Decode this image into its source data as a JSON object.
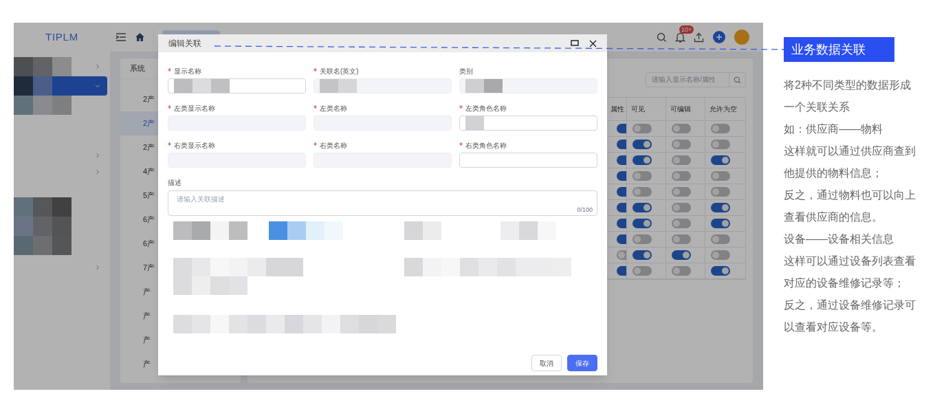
{
  "app": {
    "logo": "TIPLM",
    "notification_badge": "10+"
  },
  "sidebar": {
    "items": [
      {
        "selected": false,
        "kind": "group",
        "expanded": false
      },
      {
        "selected": true,
        "kind": "group",
        "expanded": true
      },
      {
        "selected": false,
        "kind": "item"
      }
    ]
  },
  "list": {
    "header": "系统",
    "items": [
      {
        "label": "2产",
        "selected": false
      },
      {
        "label": "2产",
        "selected": true
      },
      {
        "label": "2产",
        "selected": false
      },
      {
        "label": "4产",
        "selected": false
      },
      {
        "label": "5产",
        "selected": false
      },
      {
        "label": "6产",
        "selected": false
      },
      {
        "label": "6产",
        "selected": false
      },
      {
        "label": "7产",
        "selected": false
      },
      {
        "label": "产",
        "selected": false
      },
      {
        "label": "产",
        "selected": false
      },
      {
        "label": "产",
        "selected": false
      },
      {
        "label": "产",
        "selected": false
      }
    ]
  },
  "search": {
    "placeholder": "请输入显示名称/属性"
  },
  "table": {
    "columns": [
      "属性",
      "可见",
      "可编辑",
      "允许为空"
    ],
    "rows": [
      {
        "toggles": [
          true,
          false,
          false,
          false
        ]
      },
      {
        "toggles": [
          true,
          true,
          false,
          false
        ]
      },
      {
        "toggles": [
          true,
          true,
          false,
          true
        ]
      },
      {
        "toggles": [
          true,
          false,
          false,
          false
        ]
      },
      {
        "toggles": [
          true,
          false,
          false,
          false
        ]
      },
      {
        "toggles": [
          true,
          true,
          false,
          true
        ]
      },
      {
        "toggles": [
          true,
          true,
          false,
          true
        ]
      },
      {
        "toggles": [
          true,
          false,
          false,
          false
        ]
      },
      {
        "toggles": [
          false,
          true,
          true,
          false
        ]
      },
      {
        "toggles": [
          true,
          false,
          false,
          true
        ]
      }
    ]
  },
  "dialog": {
    "title": "编辑关联",
    "fields": [
      {
        "label": "显示名称",
        "required": true,
        "disabled": false,
        "masked": true
      },
      {
        "label": "关联名(英文)",
        "required": true,
        "disabled": true,
        "masked": true
      },
      {
        "label": "类别",
        "required": false,
        "disabled": true,
        "masked": true
      },
      {
        "label": "左类显示名称",
        "required": true,
        "disabled": true,
        "masked": false
      },
      {
        "label": "左类名称",
        "required": true,
        "disabled": true,
        "masked": false
      },
      {
        "label": "左类角色名称",
        "required": true,
        "disabled": false,
        "masked": true
      },
      {
        "label": "右类显示名称",
        "required": true,
        "disabled": true,
        "masked": false
      },
      {
        "label": "右类名称",
        "required": true,
        "disabled": true,
        "masked": false
      },
      {
        "label": "右类角色名称",
        "required": true,
        "disabled": false,
        "masked": false
      }
    ],
    "description": {
      "label": "描述",
      "placeholder": "请输入关联描述",
      "counter": "0/100"
    },
    "buttons": [
      {
        "label": "取消",
        "kind": "secondary"
      },
      {
        "label": "保存",
        "kind": "primary"
      }
    ]
  },
  "annotation": {
    "title": "业务数据关联",
    "lines": [
      "将2种不同类型的数据形成",
      "一个关联关系",
      "如：供应商——物料",
      "这样就可以通过供应商查到",
      "他提供的物料信息；",
      "反之，通过物料也可以向上",
      "查看供应商的信息。",
      "设备——设备相关信息",
      "这样可以通过设备列表查看",
      "对应的设备维修记录等；",
      "反之，通过设备维修记录可",
      "以查看对应设备等。"
    ]
  }
}
